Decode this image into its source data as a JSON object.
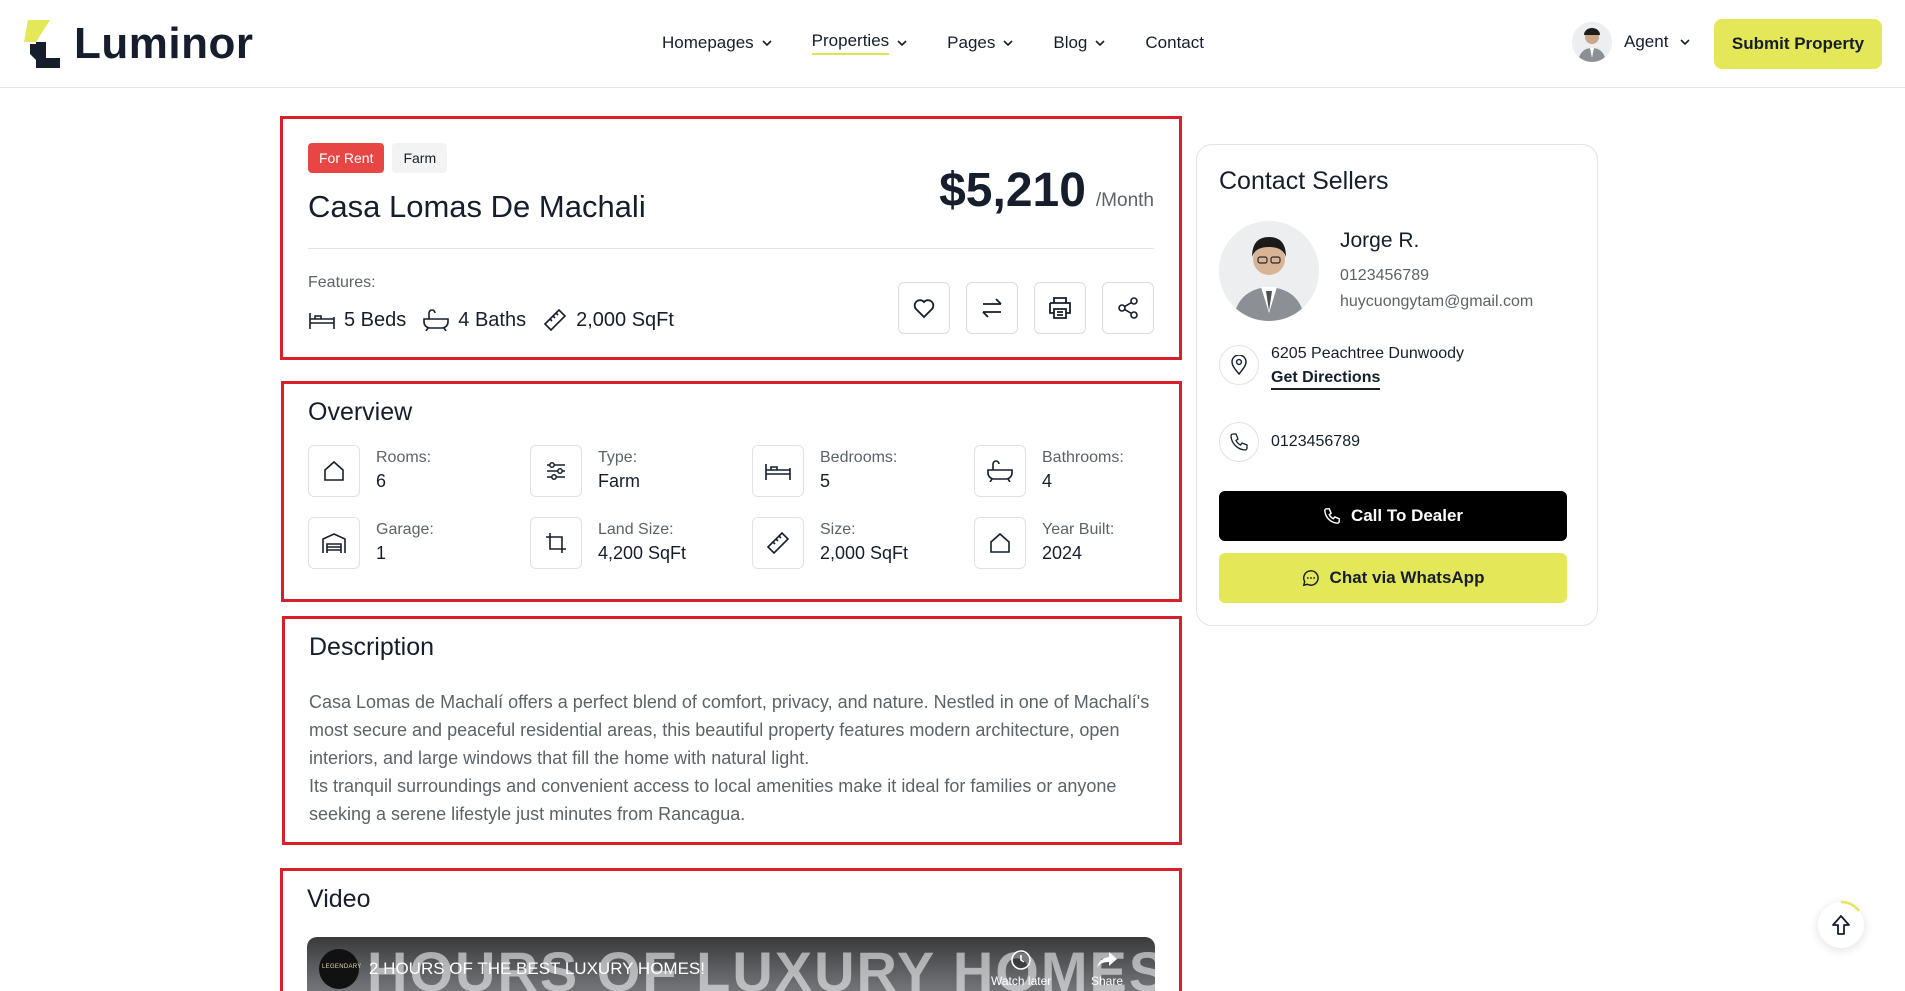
{
  "brand": {
    "name": "Luminor",
    "accent": "#e4e758",
    "danger": "#e84545",
    "dark": "#161e2d"
  },
  "nav": {
    "items": [
      {
        "label": "Homepages",
        "dropdown": true
      },
      {
        "label": "Properties",
        "dropdown": true,
        "active": true
      },
      {
        "label": "Pages",
        "dropdown": true
      },
      {
        "label": "Blog",
        "dropdown": true
      },
      {
        "label": "Contact",
        "dropdown": false
      }
    ],
    "agent_label": "Agent",
    "submit_label": "Submit Property"
  },
  "property": {
    "badges": [
      "For Rent",
      "Farm"
    ],
    "title": "Casa Lomas De Machali",
    "price": "$5,210",
    "price_unit": "/Month",
    "features_label": "Features:",
    "features": [
      {
        "icon": "bed-icon",
        "text": "5 Beds"
      },
      {
        "icon": "bathtub-icon",
        "text": "4 Baths"
      },
      {
        "icon": "ruler-icon",
        "text": "2,000 SqFt"
      }
    ],
    "actions": [
      "heart-icon",
      "compare-icon",
      "printer-icon",
      "share-icon"
    ]
  },
  "overview": {
    "title": "Overview",
    "items": [
      {
        "icon": "house-icon",
        "label": "Rooms:",
        "value": "6"
      },
      {
        "icon": "sliders-icon",
        "label": "Type:",
        "value": "Farm"
      },
      {
        "icon": "bed-icon",
        "label": "Bedrooms:",
        "value": "5"
      },
      {
        "icon": "bathtub-icon",
        "label": "Bathrooms:",
        "value": "4"
      },
      {
        "icon": "garage-icon",
        "label": "Garage:",
        "value": "1"
      },
      {
        "icon": "crop-icon",
        "label": "Land Size:",
        "value": "4,200 SqFt"
      },
      {
        "icon": "ruler-icon",
        "label": "Size:",
        "value": "2,000 SqFt"
      },
      {
        "icon": "house-icon",
        "label": "Year Built:",
        "value": "2024"
      }
    ]
  },
  "description": {
    "title": "Description",
    "paragraph1": "Casa Lomas de Machalí offers a perfect blend of comfort, privacy, and nature. Nestled in one of Machalí's most secure and peaceful residential areas, this beautiful property features modern architecture, open interiors, and large windows that fill the home with natural light.",
    "paragraph2": "Its tranquil surroundings and convenient access to local amenities make it ideal for families or anyone seeking a serene lifestyle just minutes from Rancagua."
  },
  "video": {
    "title": "Video",
    "overlay_text": "HOURS OF LUXURY HOMES",
    "channel": "LEGENDARY",
    "video_title": "2 HOURS OF THE BEST LUXURY HOMES!",
    "watch_later": "Watch later",
    "share": "Share"
  },
  "contact": {
    "title": "Contact Sellers",
    "name": "Jorge R.",
    "phone": "0123456789",
    "email": "huycuongytam@gmail.com",
    "address": "6205 Peachtree Dunwoody",
    "directions": "Get Directions",
    "phone2": "0123456789",
    "call_label": "Call To Dealer",
    "whatsapp_label": "Chat via WhatsApp"
  }
}
